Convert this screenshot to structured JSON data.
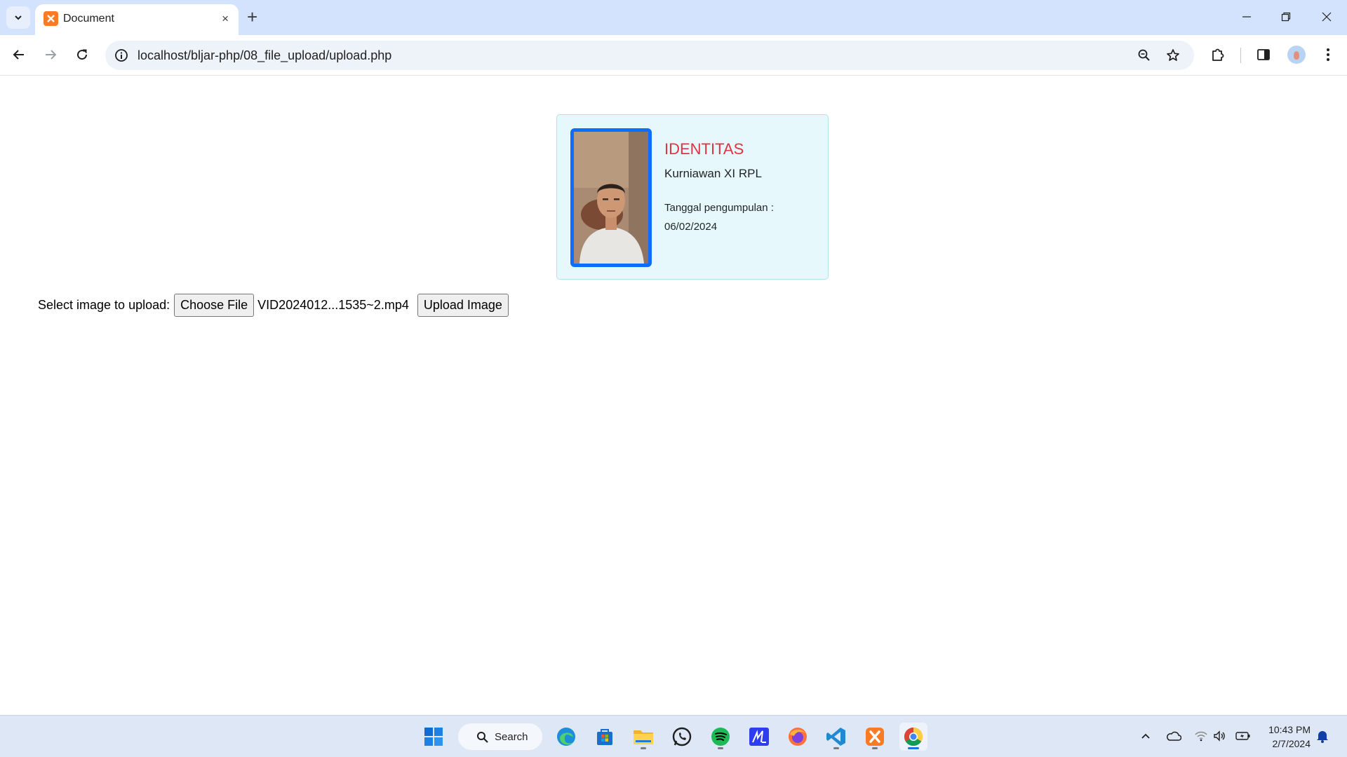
{
  "browser": {
    "tab_title": "Document",
    "tab_close": "×",
    "new_tab": "+",
    "url": "localhost/bljar-php/08_file_upload/upload.php"
  },
  "card": {
    "title": "IDENTITAS",
    "name": "Kurniawan XI RPL",
    "date_label": "Tanggal pengumpulan :",
    "date_value": "06/02/2024"
  },
  "upload": {
    "label": "Select image to upload:",
    "choose_button": "Choose File",
    "file_name": "VID2024012...1535~2.mp4",
    "submit_button": "Upload Image"
  },
  "taskbar": {
    "search_label": "Search",
    "time": "10:43 PM",
    "date": "2/7/2024"
  },
  "colors": {
    "tabstrip": "#d3e3fd",
    "card_bg": "#e6f8fb",
    "card_title": "#dc3545",
    "photo_border": "#0d6efd"
  }
}
